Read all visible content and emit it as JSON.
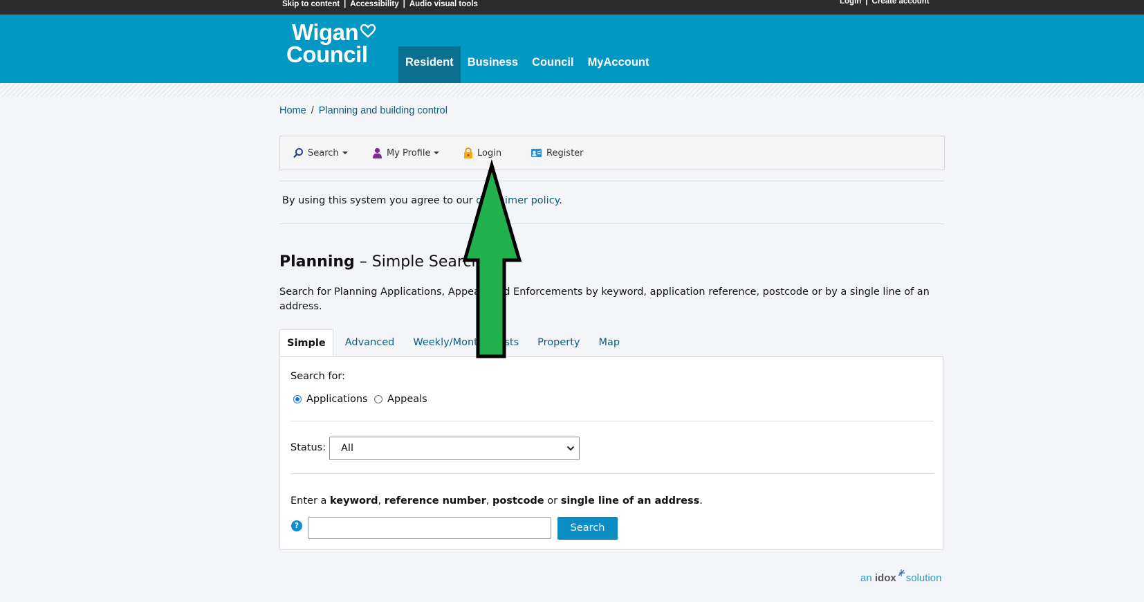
{
  "util": {
    "skip": "Skip to content",
    "accessibility": "Accessibility",
    "audio": "Audio visual tools",
    "login": "Login",
    "create": "Create account"
  },
  "logo": {
    "line1": "Wigan",
    "line2": "Council"
  },
  "nav": [
    "Resident",
    "Business",
    "Council",
    "MyAccount"
  ],
  "breadcrumb": {
    "home": "Home",
    "current": "Planning and building control"
  },
  "toolbar": {
    "search": "Search",
    "profile": "My Profile",
    "login": "Login",
    "register": "Register"
  },
  "disclaimer": {
    "text": "By using this system you agree to our ",
    "link": "disclaimer policy",
    "end": "."
  },
  "title": {
    "bold": "Planning",
    "rest": " – Simple Search"
  },
  "description": "Search for Planning Applications, Appeals and Enforcements by keyword, application reference, postcode or by a single line of an address.",
  "tabs": [
    "Simple",
    "Advanced",
    "Weekly/Monthly Lists",
    "Property",
    "Map"
  ],
  "form": {
    "search_for": "Search for:",
    "opt_applications": "Applications",
    "opt_appeals": "Appeals",
    "status_label": "Status:",
    "status_value": "All",
    "hint_pre": "Enter a ",
    "hint_k1": "keyword",
    "hint_s1": ", ",
    "hint_k2": "reference number",
    "hint_s2": ", ",
    "hint_k3": "postcode",
    "hint_s3": " or ",
    "hint_k4": "single line of an address",
    "hint_end": ".",
    "help": "?",
    "search_button": "Search"
  },
  "footer": {
    "an": "an ",
    "idox": "idox",
    "solution": "solution"
  },
  "colors": {
    "header": "#0397c4",
    "nav_active": "#0b6f8f",
    "arrow": "#22b14c"
  }
}
